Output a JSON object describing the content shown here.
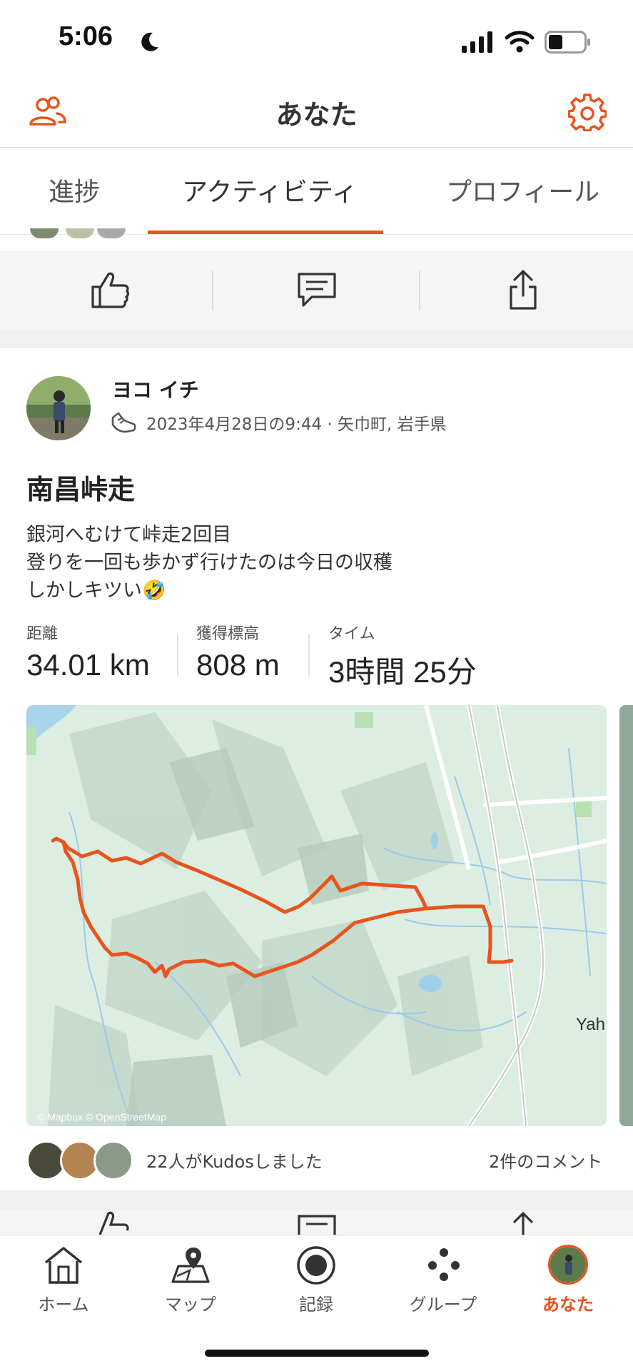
{
  "status_bar": {
    "time": "5:06"
  },
  "header": {
    "title": "あなた"
  },
  "tabs": [
    {
      "label": "進捗"
    },
    {
      "label": "アクティビティ"
    },
    {
      "label": "プロフィール"
    }
  ],
  "post": {
    "athlete_name": "ヨコ イチ",
    "meta": "2023年4月28日の9:44 · 矢巾町, 岩手県",
    "title": "南昌峠走",
    "description": [
      "銀河へむけて峠走2回目",
      "登りを一回も歩かず行けたのは今日の収穫",
      "しかしキツい🤣"
    ],
    "stats": [
      {
        "label": "距離",
        "value": "34.01 km"
      },
      {
        "label": "獲得標高",
        "value": "808 m"
      },
      {
        "label": "タイム",
        "value": "3時間 25分"
      }
    ],
    "map": {
      "attribution": "© Mapbox © OpenStreetMap",
      "place_label": "Yah",
      "route_color": "#e8541c"
    },
    "kudos_text": "22人がKudosしました",
    "comments_text": "2件のコメント"
  },
  "bottom_nav": [
    {
      "label": "ホーム"
    },
    {
      "label": "マップ"
    },
    {
      "label": "記録"
    },
    {
      "label": "グループ"
    },
    {
      "label": "あなた"
    }
  ],
  "colors": {
    "accent": "#e8541c"
  }
}
